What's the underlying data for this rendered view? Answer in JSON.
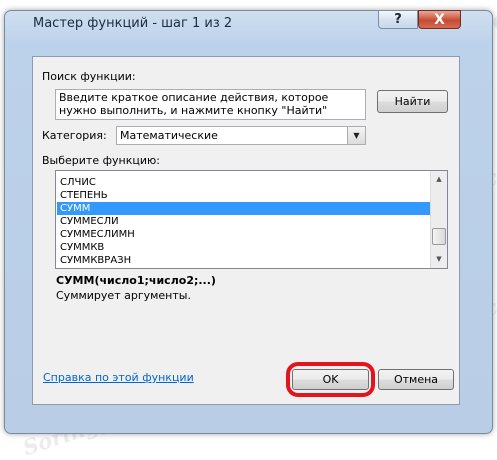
{
  "watermark": "Soringpcrepair.com",
  "window": {
    "title": "Мастер функций - шаг 1 из 2",
    "help_glyph": "?",
    "close_glyph": "X"
  },
  "search": {
    "label": "Поиск функции:",
    "value": "Введите краткое описание действия, которое нужно выполнить, и нажмите кнопку \"Найти\"",
    "find_button": "Найти"
  },
  "category": {
    "label": "Категория:",
    "selected": "Математические"
  },
  "function_list": {
    "label": "Выберите функцию:",
    "items": [
      "СЛЧИС",
      "СТЕПЕНЬ",
      "СУММ",
      "СУММЕСЛИ",
      "СУММЕСЛИМН",
      "СУММКВ",
      "СУММКВРАЗН"
    ],
    "selected_index": 2
  },
  "signature": "СУММ(число1;число2;...)",
  "description": "Суммирует аргументы.",
  "footer": {
    "help_link": "Справка по этой функции",
    "ok_button": "OK",
    "cancel_button": "Отмена"
  },
  "colors": {
    "highlight": "#e3141e",
    "selection": "#3399ff",
    "link": "#0066cc"
  }
}
